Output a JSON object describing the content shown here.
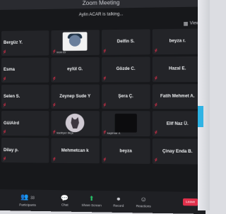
{
  "window": {
    "title": "Zoom Meeting"
  },
  "speaker": {
    "text": "Aylin ACAR is talking..."
  },
  "view_button": {
    "label": "View"
  },
  "tiles": [
    {
      "name": "Bergüz Y.",
      "label": "",
      "pic": ""
    },
    {
      "name": "",
      "label": "irem Er",
      "pic": "avatar"
    },
    {
      "name": "Delfin S.",
      "label": "",
      "pic": ""
    },
    {
      "name": "beyza r.",
      "label": "",
      "pic": ""
    },
    {
      "name": "Esma",
      "label": "",
      "pic": ""
    },
    {
      "name": "eylül G.",
      "label": "",
      "pic": ""
    },
    {
      "name": "Gözde C.",
      "label": "",
      "pic": ""
    },
    {
      "name": "Hazal E.",
      "label": "",
      "pic": ""
    },
    {
      "name": "Selen S.",
      "label": "",
      "pic": ""
    },
    {
      "name": "Zeynep Sude Y",
      "label": "",
      "pic": ""
    },
    {
      "name": "Şera Ç.",
      "label": "",
      "pic": ""
    },
    {
      "name": "Fatih Mehmet A.",
      "label": "",
      "pic": ""
    },
    {
      "name": "GülAlrd",
      "label": "",
      "pic": ""
    },
    {
      "name": "",
      "label": "kadiryer ilkçe",
      "pic": "wolf"
    },
    {
      "name": "",
      "label": "kaytmar ıl.",
      "pic": "dark"
    },
    {
      "name": "Elif Naz Ü.",
      "label": "",
      "pic": ""
    },
    {
      "name": "Dilay p.",
      "label": "",
      "pic": ""
    },
    {
      "name": "Mehmetcan k",
      "label": "",
      "pic": ""
    },
    {
      "name": "beyza",
      "label": "",
      "pic": ""
    },
    {
      "name": "Çinay Enda B.",
      "label": "",
      "pic": ""
    }
  ],
  "toolbar": {
    "participants_label": "Participants",
    "participants_count": "33",
    "chat_label": "Chat",
    "share_label": "Share Screen",
    "record_label": "Record",
    "reactions_label": "Reactions",
    "leave_label": "Leave"
  }
}
